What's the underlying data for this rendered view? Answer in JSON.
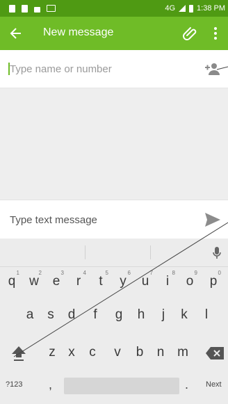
{
  "status_bar": {
    "network": "4G",
    "time": "1:38 PM"
  },
  "app_bar": {
    "title": "New message",
    "icons": [
      "back-arrow-icon",
      "paperclip-icon",
      "more-vert-icon"
    ]
  },
  "recipient": {
    "placeholder": "Type name or number"
  },
  "compose": {
    "placeholder": "Type text message"
  },
  "keyboard": {
    "row1": [
      {
        "k": "q",
        "n": "1"
      },
      {
        "k": "w",
        "n": "2"
      },
      {
        "k": "e",
        "n": "3"
      },
      {
        "k": "r",
        "n": "4"
      },
      {
        "k": "t",
        "n": "5"
      },
      {
        "k": "y",
        "n": "6"
      },
      {
        "k": "u",
        "n": "7"
      },
      {
        "k": "i",
        "n": "8"
      },
      {
        "k": "o",
        "n": "9"
      },
      {
        "k": "p",
        "n": "0"
      }
    ],
    "row2": [
      "a",
      "s",
      "d",
      "f",
      "g",
      "h",
      "j",
      "k",
      "l"
    ],
    "row3": [
      "z",
      "x",
      "c",
      "v",
      "b",
      "n",
      "m"
    ],
    "symbols_label": "?123",
    "comma": ",",
    "period": ".",
    "action_label": "Next"
  },
  "colors": {
    "status_bar": "#4f9a13",
    "app_bar": "#6fbc27",
    "accent": "#6fbc27"
  }
}
